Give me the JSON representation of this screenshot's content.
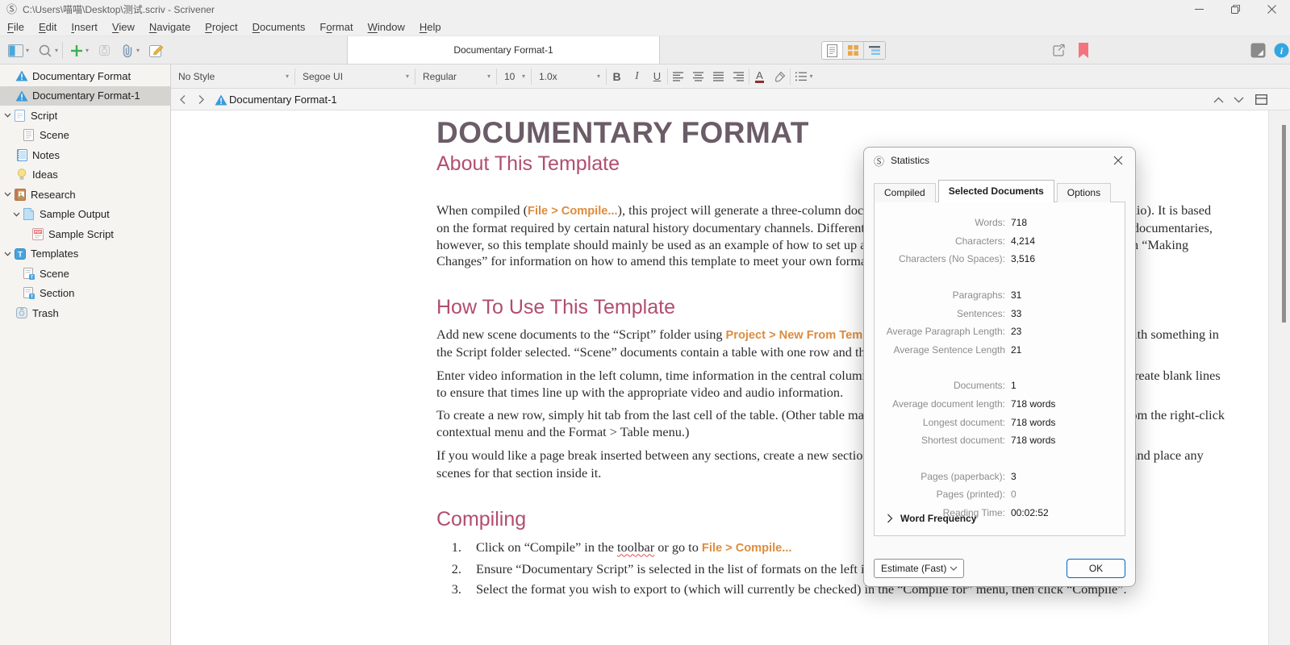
{
  "window": {
    "title": "C:\\Users\\喵喵\\Desktop\\测试.scriv - Scrivener",
    "app_logo_glyph": "Ⓢ"
  },
  "menu": {
    "items": [
      {
        "label": "File",
        "key": "F"
      },
      {
        "label": "Edit",
        "key": "E"
      },
      {
        "label": "Insert",
        "key": "I"
      },
      {
        "label": "View",
        "key": "V"
      },
      {
        "label": "Navigate",
        "key": "N"
      },
      {
        "label": "Project",
        "key": "P"
      },
      {
        "label": "Documents",
        "key": "D"
      },
      {
        "label": "Format",
        "key": "o"
      },
      {
        "label": "Window",
        "key": "W"
      },
      {
        "label": "Help",
        "key": "H"
      }
    ]
  },
  "toolbar": {
    "tab_label": "Documentary Format-1",
    "icons": [
      "binder-toggle",
      "search",
      "add",
      "trash",
      "attach",
      "compose",
      "view-document",
      "view-corkboard",
      "view-outliner",
      "share",
      "bookmark",
      "compose-mode",
      "inspector-info"
    ]
  },
  "binder": {
    "items": [
      {
        "label": "Documentary Format",
        "icon": "warning-doc",
        "depth": 0,
        "indent_extra": 1
      },
      {
        "label": "Documentary Format-1",
        "icon": "warning-doc",
        "depth": 0,
        "indent_extra": 1,
        "selected": true
      },
      {
        "label": "Script",
        "icon": "folder-script",
        "depth": 0,
        "expanded": true
      },
      {
        "label": "Scene",
        "icon": "page-lines",
        "depth": 1
      },
      {
        "label": "Notes",
        "icon": "notebook",
        "depth": 0,
        "indent_extra": 1
      },
      {
        "label": "Ideas",
        "icon": "lightbulb",
        "depth": 0,
        "indent_extra": 1
      },
      {
        "label": "Research",
        "icon": "book",
        "depth": 0,
        "expanded": true
      },
      {
        "label": "Sample Output",
        "icon": "page-blue",
        "depth": 1,
        "expanded": true
      },
      {
        "label": "Sample Script",
        "icon": "pdf",
        "depth": 2
      },
      {
        "label": "Templates",
        "icon": "template-t",
        "depth": 0,
        "expanded": true
      },
      {
        "label": "Scene",
        "icon": "page-template",
        "depth": 1
      },
      {
        "label": "Section",
        "icon": "page-template",
        "depth": 1
      },
      {
        "label": "Trash",
        "icon": "trash",
        "depth": 0,
        "indent_extra": 1
      }
    ]
  },
  "format_bar": {
    "style": "No Style",
    "font": "Segoe UI",
    "weight": "Regular",
    "size": "10",
    "spacing": "1.0x",
    "bold": "B",
    "italic": "I",
    "underline": "U",
    "color_letter": "A"
  },
  "editor_header": {
    "title": "Documentary Format-1"
  },
  "document": {
    "blocks": [
      {
        "type": "h1",
        "text": "DOCUMENTARY FORMAT"
      },
      {
        "type": "h2",
        "subtitle": true,
        "text": "About This Template"
      },
      {
        "type": "p",
        "first": true,
        "runs": [
          {
            "t": "When compiled ("
          },
          {
            "t": "File > Compile...",
            "link": true
          },
          {
            "t": "), this project will generate a three-column document (the three columns being video, time and audio). It is based on the format required by certain natural history documentary channels. Different companies have different format requirements for documentaries, however, so this template should mainly be used as an example of how to set up a documentary script in Scrivener. See the section on “Making Changes” for information on how to amend this template to meet your own formatting needs."
          }
        ]
      },
      {
        "type": "h2",
        "text": "How To Use This Template"
      },
      {
        "type": "p",
        "runs": [
          {
            "t": "Add new scene documents to the “Script” folder using "
          },
          {
            "t": "Project > New From Template > Scene",
            "link": true
          },
          {
            "t": ". Alternatively, just click on “Add” with something in the Script folder selected. “Scene” documents contain a table with one row and three columns."
          }
        ]
      },
      {
        "type": "p",
        "runs": [
          {
            "t": "Enter video information in the left column, time information in the central column, and audio in the right column. You may need to create blank lines to ensure that times line up with the appropriate video and audio information."
          }
        ]
      },
      {
        "type": "p",
        "runs": [
          {
            "t": "To create a new row, simply hit tab from the last cell of the table. (Other table manipulations, such as inserting rows, are available from the right-click contextual menu and the Format > Table menu.)"
          }
        ]
      },
      {
        "type": "p",
        "runs": [
          {
            "t": "If you would like a page break inserted between any sections, create a new section using "
          },
          {
            "t": "Project > New From Template > Section",
            "link": true
          },
          {
            "t": ", and place any scenes for that section inside it."
          }
        ]
      },
      {
        "type": "h2",
        "text": "Compiling"
      },
      {
        "type": "li",
        "num": "1.",
        "runs": [
          {
            "t": "Click on “Compile” in the "
          },
          {
            "t": "toolbar",
            "wavy": true
          },
          {
            "t": " or go to "
          },
          {
            "t": "File > Compile...",
            "link": true
          }
        ]
      },
      {
        "type": "li",
        "num": "2.",
        "runs": [
          {
            "t": "Ensure “Documentary Script” is selected in the list of formats on the left in the Compile panel."
          }
        ]
      },
      {
        "type": "li",
        "num": "3.",
        "runs": [
          {
            "t": "Select the format you wish to export to (which will currently be checked) in the “Compile for” menu, then click “Compile”."
          }
        ]
      }
    ]
  },
  "dialog": {
    "title": "Statistics",
    "tabs": [
      "Compiled",
      "Selected Documents",
      "Options"
    ],
    "active_tab": "Selected Documents",
    "stat_groups": [
      [
        {
          "label": "Words:",
          "value": "718"
        },
        {
          "label": "Characters:",
          "value": "4,214"
        },
        {
          "label": "Characters (No Spaces):",
          "value": "3,516"
        }
      ],
      [
        {
          "label": "Paragraphs:",
          "value": "31"
        },
        {
          "label": "Sentences:",
          "value": "33"
        },
        {
          "label": "Average Paragraph Length:",
          "value": "23"
        },
        {
          "label": "Average Sentence Length",
          "value": "21"
        }
      ],
      [
        {
          "label": "Documents:",
          "value": "1"
        },
        {
          "label": "Average document length:",
          "value": "718 words"
        },
        {
          "label": "Longest document:",
          "value": "718 words"
        },
        {
          "label": "Shortest document:",
          "value": "718 words"
        }
      ],
      [
        {
          "label": "Pages (paperback):",
          "value": "3"
        },
        {
          "label": "Pages (printed):",
          "value": "0",
          "muted": true
        },
        {
          "label": "Reading Time:",
          "value": "00:02:52"
        }
      ]
    ],
    "word_frequency_label": "Word Frequency",
    "estimate_label": "Estimate (Fast)",
    "ok_label": "OK"
  },
  "colors": {
    "heading1": "#6b5c67",
    "heading2": "#b14e6e",
    "link": "#dd8c3e",
    "accent_blue": "#35a5e0",
    "bookmark_red": "#f4747e",
    "corkboard_orange": "#e8a64a",
    "ok_border": "#0067c0"
  }
}
